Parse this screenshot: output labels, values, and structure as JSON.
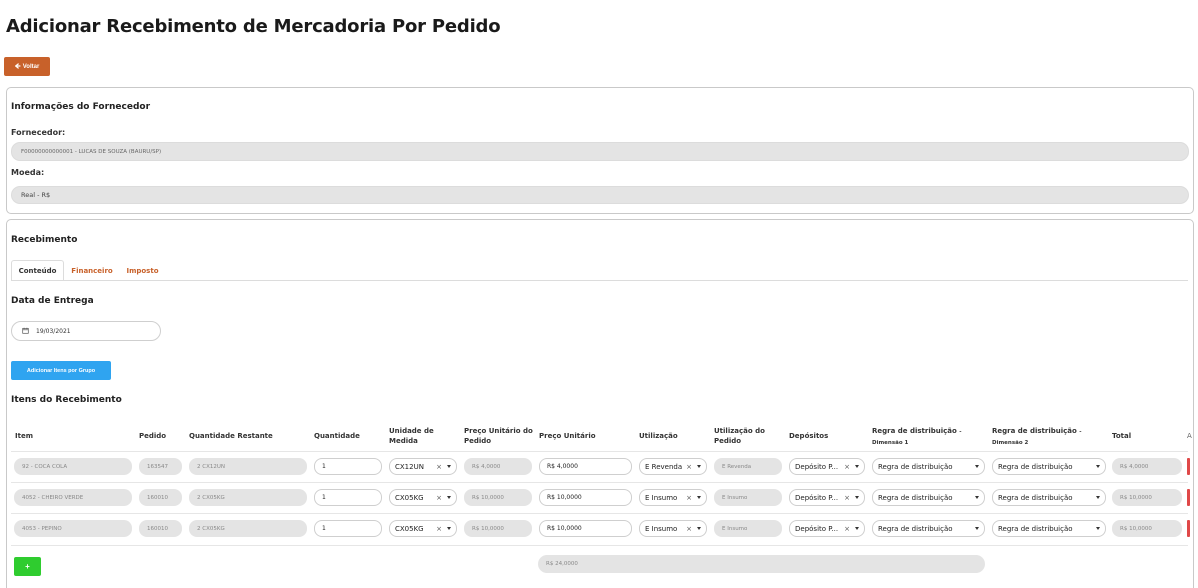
{
  "page": {
    "title": "Adicionar Recebimento de Mercadoria Por Pedido",
    "back_label": "Voltar"
  },
  "fornecedor_card": {
    "title": "Informações do Fornecedor",
    "fornecedor_label": "Fornecedor:",
    "fornecedor_value": "F00000000000001 - LUCAS DE SOUZA (BAURU/SP)",
    "moeda_label": "Moeda:",
    "moeda_value": "Real - R$"
  },
  "recebimento": {
    "title": "Recebimento",
    "tabs": [
      {
        "label": "Conteúdo",
        "active": true
      },
      {
        "label": "Financeiro",
        "active": false
      },
      {
        "label": "Imposto",
        "active": false
      }
    ],
    "data_entrega_label": "Data de Entrega",
    "data_entrega_value": "19/03/2021",
    "add_group_button": "Adicionar Itens por Grupo",
    "itens_title": "Itens do Recebimento",
    "columns": {
      "item": "Item",
      "pedido": "Pedido",
      "qtd_restante": "Quantidade Restante",
      "quantidade": "Quantidade",
      "unidade": "Unidade de Medida",
      "preco_pedido": "Preço Unitário do Pedido",
      "preco_unitario": "Preço Unitário",
      "utilizacao": "Utilização",
      "utilizacao_pedido": "Utilização do Pedido",
      "depositos": "Depósitos",
      "regra1": "Regra de distribuição",
      "regra1_dim": "- Dimensão 1",
      "regra2": "Regra de distribuição",
      "regra2_dim": "- Dimensão 2",
      "total": "Total",
      "extra": "A"
    },
    "rows": [
      {
        "item": "92 - COCA COLA",
        "pedido": "163547",
        "qtd_restante": "2 CX12UN",
        "quantidade": "1",
        "unidade": "CX12UN",
        "preco_pedido": "R$ 4,0000",
        "preco_unitario": "R$ 4,0000",
        "utilizacao": "E Revenda",
        "utilizacao_pedido": "E Revenda",
        "deposito": "Depósito P...",
        "regra1": "Regra de distribuição",
        "regra2": "Regra de distribuição",
        "total": "R$ 4,0000"
      },
      {
        "item": "4052 - CHEIRO VERDE",
        "pedido": "160010",
        "qtd_restante": "2 CX05KG",
        "quantidade": "1",
        "unidade": "CX05KG",
        "preco_pedido": "R$ 10,0000",
        "preco_unitario": "R$ 10,0000",
        "utilizacao": "E Insumo",
        "utilizacao_pedido": "E Insumo",
        "deposito": "Depósito P...",
        "regra1": "Regra de distribuição",
        "regra2": "Regra de distribuição",
        "total": "R$ 10,0000"
      },
      {
        "item": "4053 - PEPINO",
        "pedido": "160010",
        "qtd_restante": "2 CX05KG",
        "quantidade": "1",
        "unidade": "CX05KG",
        "preco_pedido": "R$ 10,0000",
        "preco_unitario": "R$ 10,0000",
        "utilizacao": "E Insumo",
        "utilizacao_pedido": "E Insumo",
        "deposito": "Depósito P...",
        "regra1": "Regra de distribuição",
        "regra2": "Regra de distribuição",
        "total": "R$ 10,0000"
      }
    ],
    "add_row_label": "+",
    "grand_total": "R$ 24,0000"
  },
  "colors": {
    "accent_orange": "#c8612a",
    "button_blue": "#2fa4f0",
    "button_green": "#2fcc2f",
    "readonly_bg": "#e4e4e4",
    "remove_red": "#e04848"
  },
  "icons": {
    "back": "arrow-left-icon",
    "calendar": "calendar-icon",
    "clear": "close-icon",
    "dropdown": "caret-down-icon"
  }
}
